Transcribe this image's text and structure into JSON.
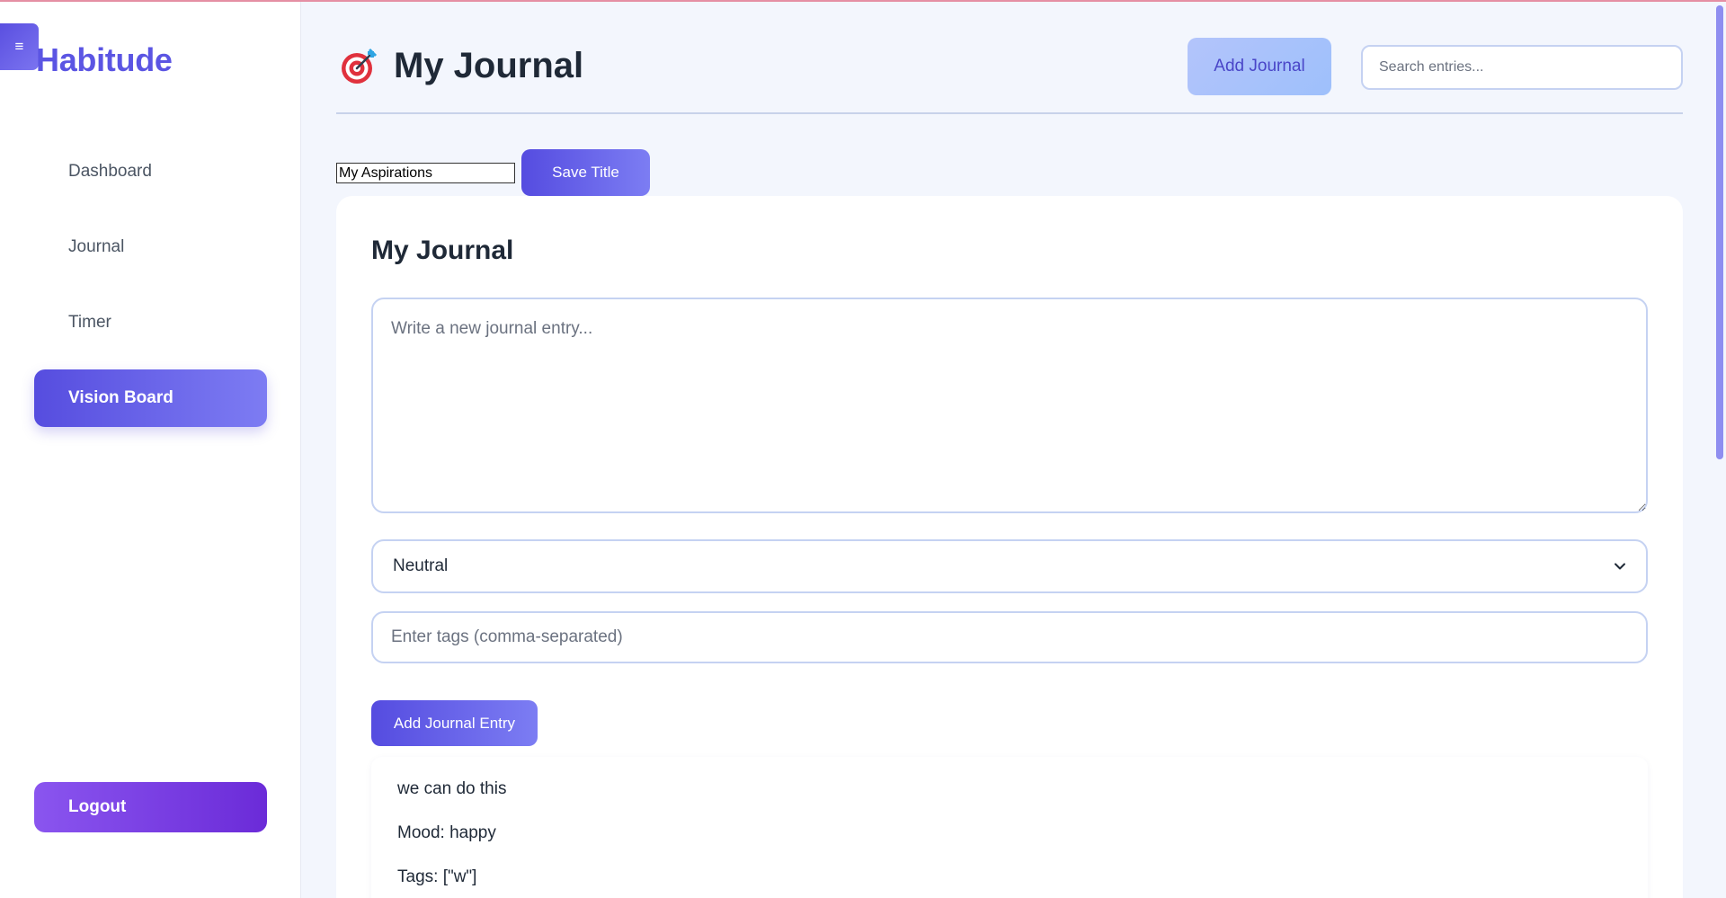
{
  "sidebar": {
    "menu_toggle": "≡",
    "brand": "Habitude",
    "items": [
      {
        "label": "Dashboard",
        "active": false
      },
      {
        "label": "Journal",
        "active": false
      },
      {
        "label": "Timer",
        "active": false
      },
      {
        "label": "Vision Board",
        "active": true
      }
    ],
    "logout_label": "Logout"
  },
  "header": {
    "icon": "target-icon",
    "title": "My Journal",
    "add_journal_label": "Add Journal",
    "search_placeholder": "Search entries..."
  },
  "title_edit": {
    "value": "My Aspirations",
    "save_label": "Save Title"
  },
  "journal_card": {
    "title": "My Journal",
    "entry_placeholder": "Write a new journal entry...",
    "mood_selected": "Neutral",
    "tags_placeholder": "Enter tags (comma-separated)",
    "add_entry_label": "Add Journal Entry",
    "entries": [
      {
        "text": "we can do this",
        "mood": "Mood: happy",
        "tags": "Tags: [\"w\"]"
      }
    ]
  },
  "colors": {
    "accent": "#5b55e3",
    "logout": "#7a3fe4",
    "background": "#f3f6fd"
  }
}
